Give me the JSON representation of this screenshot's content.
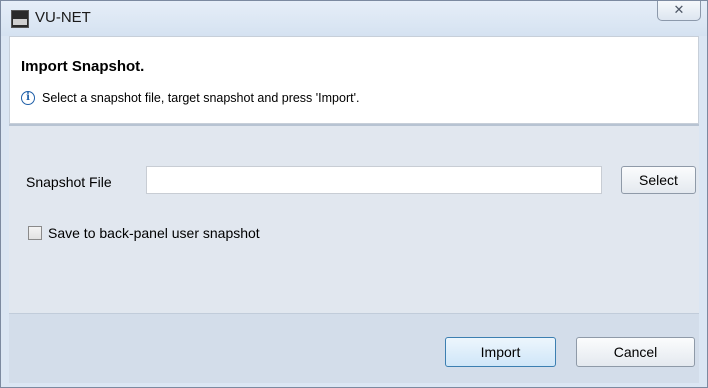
{
  "window": {
    "title": "VU-NET",
    "close_glyph": "✕"
  },
  "header": {
    "title": "Import Snapshot.",
    "info_glyph": "i",
    "message": "Select a snapshot file, target snapshot and press 'Import'."
  },
  "form": {
    "snapshot_file_label": "Snapshot File",
    "snapshot_file_value": "",
    "select_label": "Select",
    "checkbox_label": "Save to back-panel user snapshot",
    "checkbox_checked": false
  },
  "footer": {
    "import_label": "Import",
    "cancel_label": "Cancel"
  },
  "icons": {
    "app": "vu-net-app-icon",
    "close": "close-icon",
    "info": "info-icon"
  }
}
